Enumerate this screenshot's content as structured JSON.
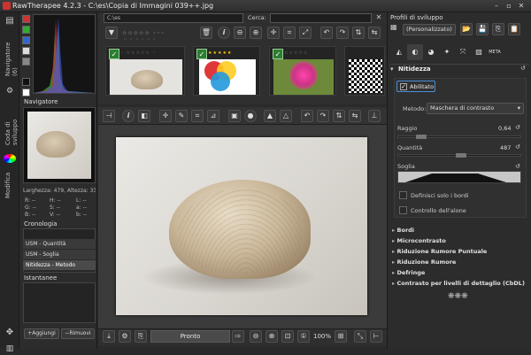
{
  "window": {
    "title": "RawTherapee 4.2.3 - C:\\es\\Copia di Immagini 039++.jpg",
    "min": "–",
    "max": "▫",
    "close": "✕"
  },
  "leftstrip": {
    "tab1": "Navigatore (6)",
    "tab2": "Coda di sviluppo",
    "tab3": "Modifica"
  },
  "navigator": {
    "header": "Navigatore",
    "size_text": "Larghezza: 479, Altezza: 330",
    "r": "R: --",
    "g": "G: --",
    "b": "B: --",
    "h": "H: --",
    "s": "S: --",
    "v": "V: --",
    "l": "L: --",
    "a": "a: --",
    "bb": "b: --"
  },
  "history": {
    "header": "Cronologia",
    "items": [
      "USM - Quantità",
      "USM - Soglia",
      "Nitidezza - Metodo"
    ]
  },
  "snapshots": {
    "header": "Istantanee",
    "add": "Aggiungi",
    "remove": "Rimuovi"
  },
  "filebrowser": {
    "path": "C:\\es",
    "search_label": "Cerca:",
    "search_value": ""
  },
  "editor": {
    "status": "Pronto",
    "zoom": "100%"
  },
  "profile": {
    "header": "Profili di sviluppo",
    "selected": "(Personalizzato)"
  },
  "sharpening": {
    "header": "Nitidezza",
    "enabled_label": "Abilitato",
    "method_label": "Metodo:",
    "method_value": "Maschera di contrasto",
    "radius_label": "Raggio",
    "radius_value": "0,64",
    "amount_label": "Quantità",
    "amount_value": "487",
    "threshold_label": "Soglia",
    "edges_only": "Definisci solo i bordi",
    "halo_control": "Controllo dell'alone"
  },
  "tools": [
    "Bordi",
    "Microcontrasto",
    "Riduzione Rumore Puntuale",
    "Riduzione Rumore",
    "Defringe",
    "Contrasto per livelli di dettaglio (CbDL)"
  ],
  "colors": {
    "accent": "#4a90d9",
    "check": "#2e7d32"
  }
}
